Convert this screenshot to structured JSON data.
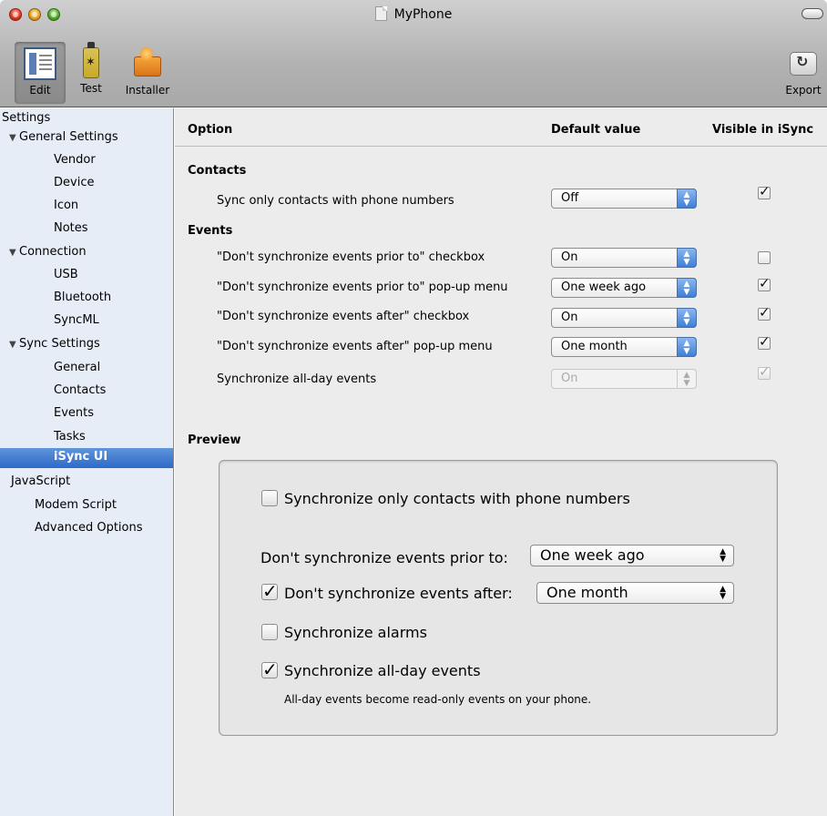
{
  "window": {
    "title": "MyPhone"
  },
  "toolbar": {
    "edit_label": "Edit",
    "test_label": "Test",
    "installer_label": "Installer",
    "export_label": "Export"
  },
  "sidebar": {
    "items": [
      {
        "label": "Settings"
      },
      {
        "label": "General Settings"
      },
      {
        "label": "Vendor"
      },
      {
        "label": "Device"
      },
      {
        "label": "Icon"
      },
      {
        "label": "Notes"
      },
      {
        "label": "Connection"
      },
      {
        "label": "USB"
      },
      {
        "label": "Bluetooth"
      },
      {
        "label": "SyncML"
      },
      {
        "label": "Sync Settings"
      },
      {
        "label": "General"
      },
      {
        "label": "Contacts"
      },
      {
        "label": "Events"
      },
      {
        "label": "Tasks"
      },
      {
        "label": "iSync UI"
      },
      {
        "label": "JavaScript"
      },
      {
        "label": "Modem Script"
      },
      {
        "label": "Advanced Options"
      }
    ]
  },
  "table": {
    "col_option": "Option",
    "col_default": "Default value",
    "col_visible": "Visible in iSync"
  },
  "contacts": {
    "title": "Contacts",
    "rows": [
      {
        "label": "Sync only contacts with phone numbers",
        "value": "Off",
        "visible": true,
        "enabled": true
      }
    ]
  },
  "events": {
    "title": "Events",
    "rows": [
      {
        "label": "\"Don't synchronize events prior to\" checkbox",
        "value": "On",
        "visible": false,
        "enabled": true
      },
      {
        "label": "\"Don't synchronize events prior to\" pop-up menu",
        "value": "One week ago",
        "visible": true,
        "enabled": true
      },
      {
        "label": "\"Don't synchronize events after\" checkbox",
        "value": "On",
        "visible": true,
        "enabled": true
      },
      {
        "label": "\"Don't synchronize events after\" pop-up menu",
        "value": "One month",
        "visible": true,
        "enabled": true
      },
      {
        "label": "Synchronize all-day events",
        "value": "On",
        "visible": true,
        "enabled": false
      }
    ]
  },
  "preview": {
    "title": "Preview",
    "contacts_only_label": "Synchronize only contacts with phone numbers",
    "contacts_only_checked": false,
    "prior_label": "Don't synchronize events prior to:",
    "prior_value": "One week ago",
    "after_label": "Don't synchronize events after:",
    "after_checked": true,
    "after_value": "One month",
    "alarms_label": "Synchronize alarms",
    "alarms_checked": false,
    "allday_label": "Synchronize all-day events",
    "allday_checked": true,
    "allday_note": "All-day events become read-only events on your phone."
  }
}
